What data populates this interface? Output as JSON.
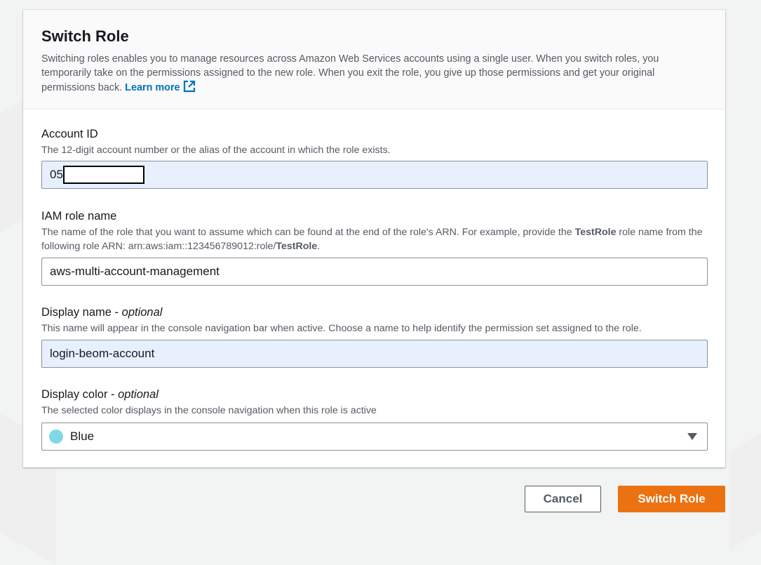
{
  "header": {
    "title": "Switch Role",
    "description": "Switching roles enables you to manage resources across Amazon Web Services accounts using a single user. When you switch roles, you temporarily take on the permissions assigned to the new role. When you exit the role, you give up those permissions and get your original permissions back.",
    "learn_more": "Learn more",
    "external_icon": "external-link-icon"
  },
  "account_id": {
    "label": "Account ID",
    "hint": "The 12-digit account number or the alias of the account in which the role exists.",
    "value_visible": "05"
  },
  "role_name": {
    "label": "IAM role name",
    "hint_part1": "The name of the role that you want to assume which can be found at the end of the role's ARN. For example, provide the ",
    "hint_bold1": "TestRole",
    "hint_part2": " role name from the following role ARN: arn:aws:iam::123456789012:role/",
    "hint_bold2": "TestRole",
    "hint_part3": ".",
    "value": "aws-multi-account-management"
  },
  "display_name": {
    "label": "Display name",
    "label_suffix": "optional",
    "hint": "This name will appear in the console navigation bar when active. Choose a name to help identify the permission set assigned to the role.",
    "value": "login-beom-account"
  },
  "display_color": {
    "label": "Display color",
    "label_suffix": "optional",
    "hint": "The selected color displays in the console navigation when this role is active",
    "selected": "Blue",
    "swatch_color": "#7fd8e8"
  },
  "actions": {
    "cancel": "Cancel",
    "submit": "Switch Role"
  },
  "colors": {
    "accent_link": "#0073bb",
    "primary_button": "#ec7211",
    "autofill_bg": "#e8f0fe"
  }
}
